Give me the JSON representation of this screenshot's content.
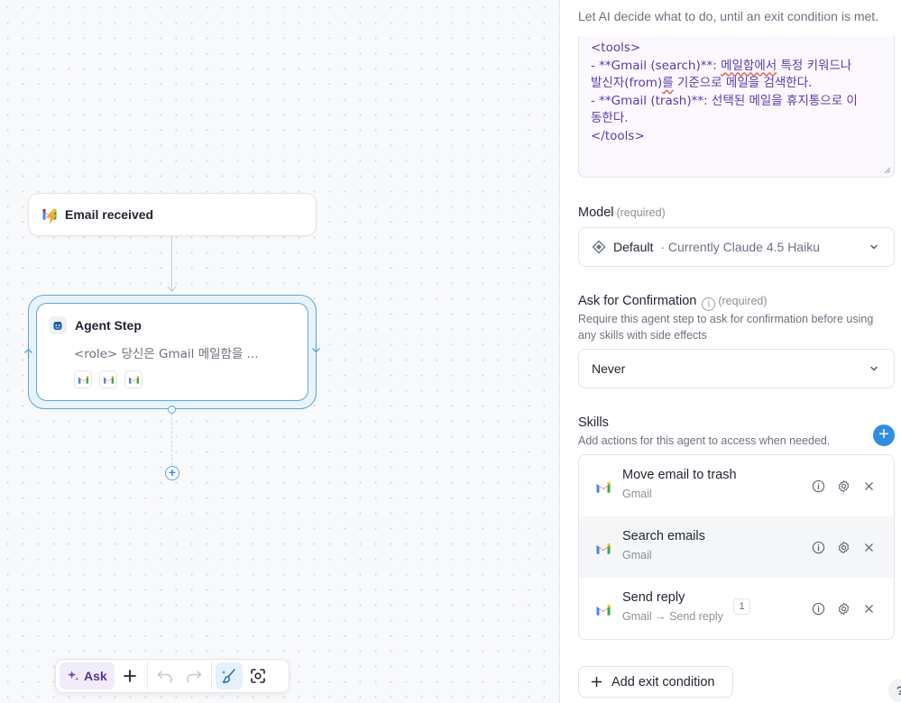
{
  "canvas": {
    "trigger_node": {
      "title": "Email received",
      "icon": "gmail-icon"
    },
    "agent_node": {
      "title": "Agent Step",
      "description": "<role> 당신은 Gmail 메일함을 ...",
      "tools": [
        "gmail-icon",
        "gmail-icon",
        "gmail-icon"
      ]
    },
    "toolbar": {
      "ask_label": "Ask",
      "items": [
        "sparkle-icon",
        "plus-icon",
        "undo-icon",
        "redo-icon",
        "tidy-icon",
        "focus-icon"
      ]
    }
  },
  "panel": {
    "subtitle": "Let AI decide what to do, until an exit condition is met.",
    "prompt_lines": [
      "<tools>",
      "- **Gmail (search)**: ",
      "메일함에서",
      " 특정 키워드나",
      "발신자(from)",
      "를",
      " 기준으로 메일을 검색한다.",
      "- **Gmail (trash)**: 선택된 메일을 휴지통으로 이",
      "동한다.",
      "</tools>"
    ],
    "model": {
      "label": "Model",
      "required": "(required)",
      "value": "Default",
      "note": "· Currently Claude 4.5 Haiku"
    },
    "confirmation": {
      "label": "Ask for Confirmation",
      "required": "(required)",
      "help": "Require this agent step to ask for confirmation before using any skills with side effects",
      "value": "Never"
    },
    "skills": {
      "label": "Skills",
      "help": "Add actions for this agent to access when needed.",
      "items": [
        {
          "name": "Move email to trash",
          "sub": "Gmail",
          "badge": ""
        },
        {
          "name": "Search emails",
          "sub": "Gmail",
          "badge": ""
        },
        {
          "name": "Send reply",
          "sub": "Gmail → Send reply",
          "badge": "1"
        }
      ]
    },
    "exit_button": "Add exit condition",
    "help_button": "?"
  }
}
